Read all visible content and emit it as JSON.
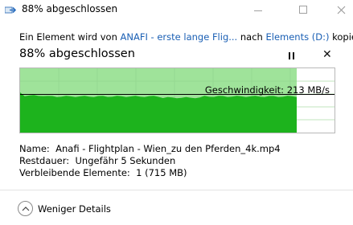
{
  "window": {
    "title": "88% abgeschlossen",
    "app_icon": "copy-arrow-icon",
    "controls": [
      "minimize-icon",
      "maximize-icon",
      "close-icon"
    ]
  },
  "copy": {
    "prefix": "Ein Element wird von ",
    "source": "ANAFI - erste lange Flig...",
    "middle": " nach ",
    "destination": "Elements (D:)",
    "suffix": " kopiert"
  },
  "progress": {
    "status_text": "88% abgeschlossen",
    "percent": 88,
    "pause_icon": "pause-icon",
    "cancel_icon": "close-icon"
  },
  "speed": {
    "label": "Geschwindigkeit: 213 MB/s",
    "current_fraction": 0.6
  },
  "details": {
    "name_label": "Name:",
    "name_value": "Anafi - Flightplan - Wien_zu den Pferden_4k.mp4",
    "remaining_label": "Restdauer:",
    "remaining_value": "Ungefähr 5 Sekunden",
    "items_label": "Verbleibende Elemente:",
    "items_value": "1 (715 MB)"
  },
  "footer": {
    "toggle_label": "Weniger Details",
    "toggle_icon": "chevron-up-icon"
  },
  "colors": {
    "fill_light": "#9fe39a",
    "fill_dark": "#1db31d",
    "link": "#1a5fb4"
  }
}
